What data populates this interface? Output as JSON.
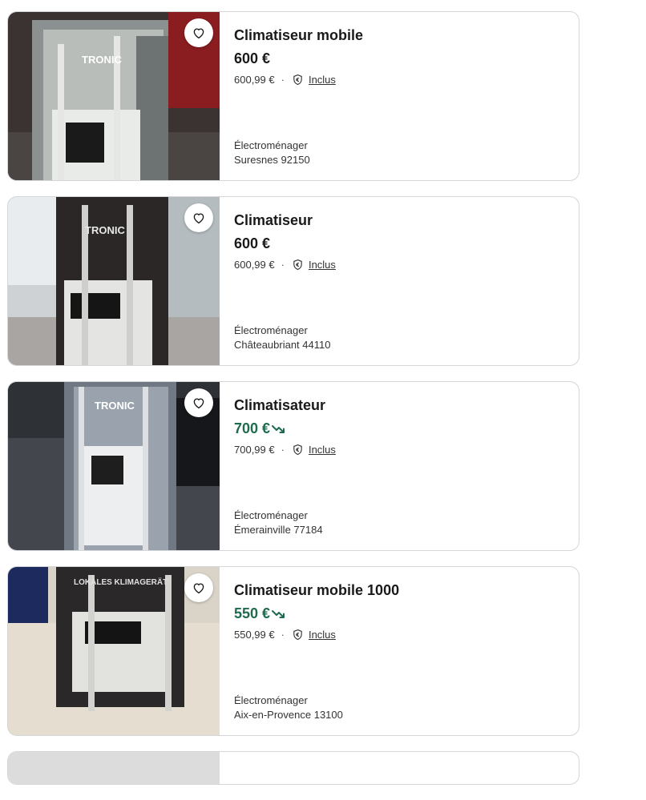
{
  "listings": [
    {
      "title": "Climatiseur mobile",
      "price": "600 €",
      "price_drop": false,
      "total_price": "600,99 €",
      "separator": "·",
      "protection_label": "Inclus",
      "category": "Électroménager",
      "location": "Suresnes 92150"
    },
    {
      "title": "Climatiseur",
      "price": "600 €",
      "price_drop": false,
      "total_price": "600,99 €",
      "separator": "·",
      "protection_label": "Inclus",
      "category": "Électroménager",
      "location": "Châteaubriant 44110"
    },
    {
      "title": "Climatisateur",
      "price": "700 €",
      "price_drop": true,
      "total_price": "700,99 €",
      "separator": "·",
      "protection_label": "Inclus",
      "category": "Électroménager",
      "location": "Émerainville 77184"
    },
    {
      "title": "Climatiseur mobile 1000",
      "price": "550 €",
      "price_drop": true,
      "total_price": "550,99 €",
      "separator": "·",
      "protection_label": "Inclus",
      "category": "Électroménager",
      "location": "Aix-en-Provence 13100"
    }
  ],
  "colors": {
    "price_drop": "#1e6b4e",
    "text": "#1a1a1a",
    "border": "#d4d6da"
  },
  "icons": {
    "favorite": "heart-outline-icon",
    "protection": "shield-euro-icon",
    "price_trend": "trending-down-icon"
  }
}
